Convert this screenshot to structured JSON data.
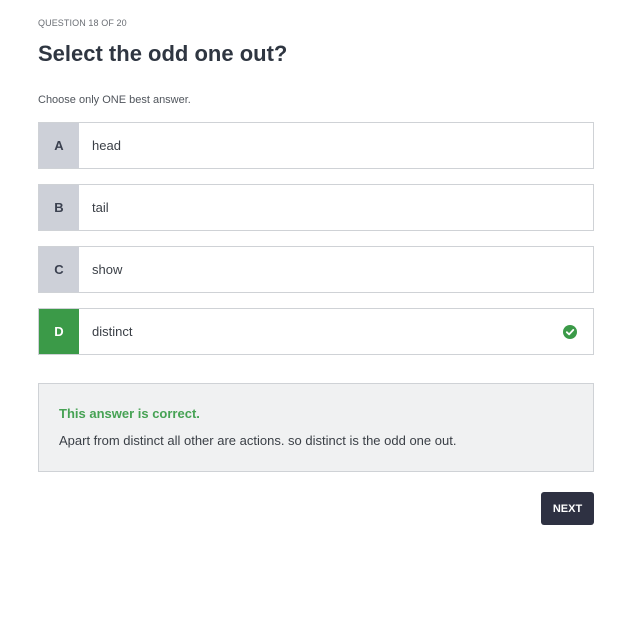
{
  "quiz": {
    "counter": "QUESTION 18 OF 20",
    "question": "Select the odd one out?",
    "instruction": "Choose only ONE best answer.",
    "options": [
      {
        "letter": "A",
        "text": "head"
      },
      {
        "letter": "B",
        "text": "tail"
      },
      {
        "letter": "C",
        "text": "show"
      },
      {
        "letter": "D",
        "text": "distinct"
      }
    ],
    "selected_option": "D",
    "feedback": {
      "title": "This answer is correct.",
      "explanation": "Apart from distinct all other are actions. so distinct is the odd one out."
    },
    "next_label": "NEXT"
  },
  "icons": {
    "correct": "check-circle-icon"
  },
  "colors": {
    "correct_green": "#3b9a48",
    "letter_bg": "#cdd0d8",
    "button_bg": "#2e3142"
  }
}
